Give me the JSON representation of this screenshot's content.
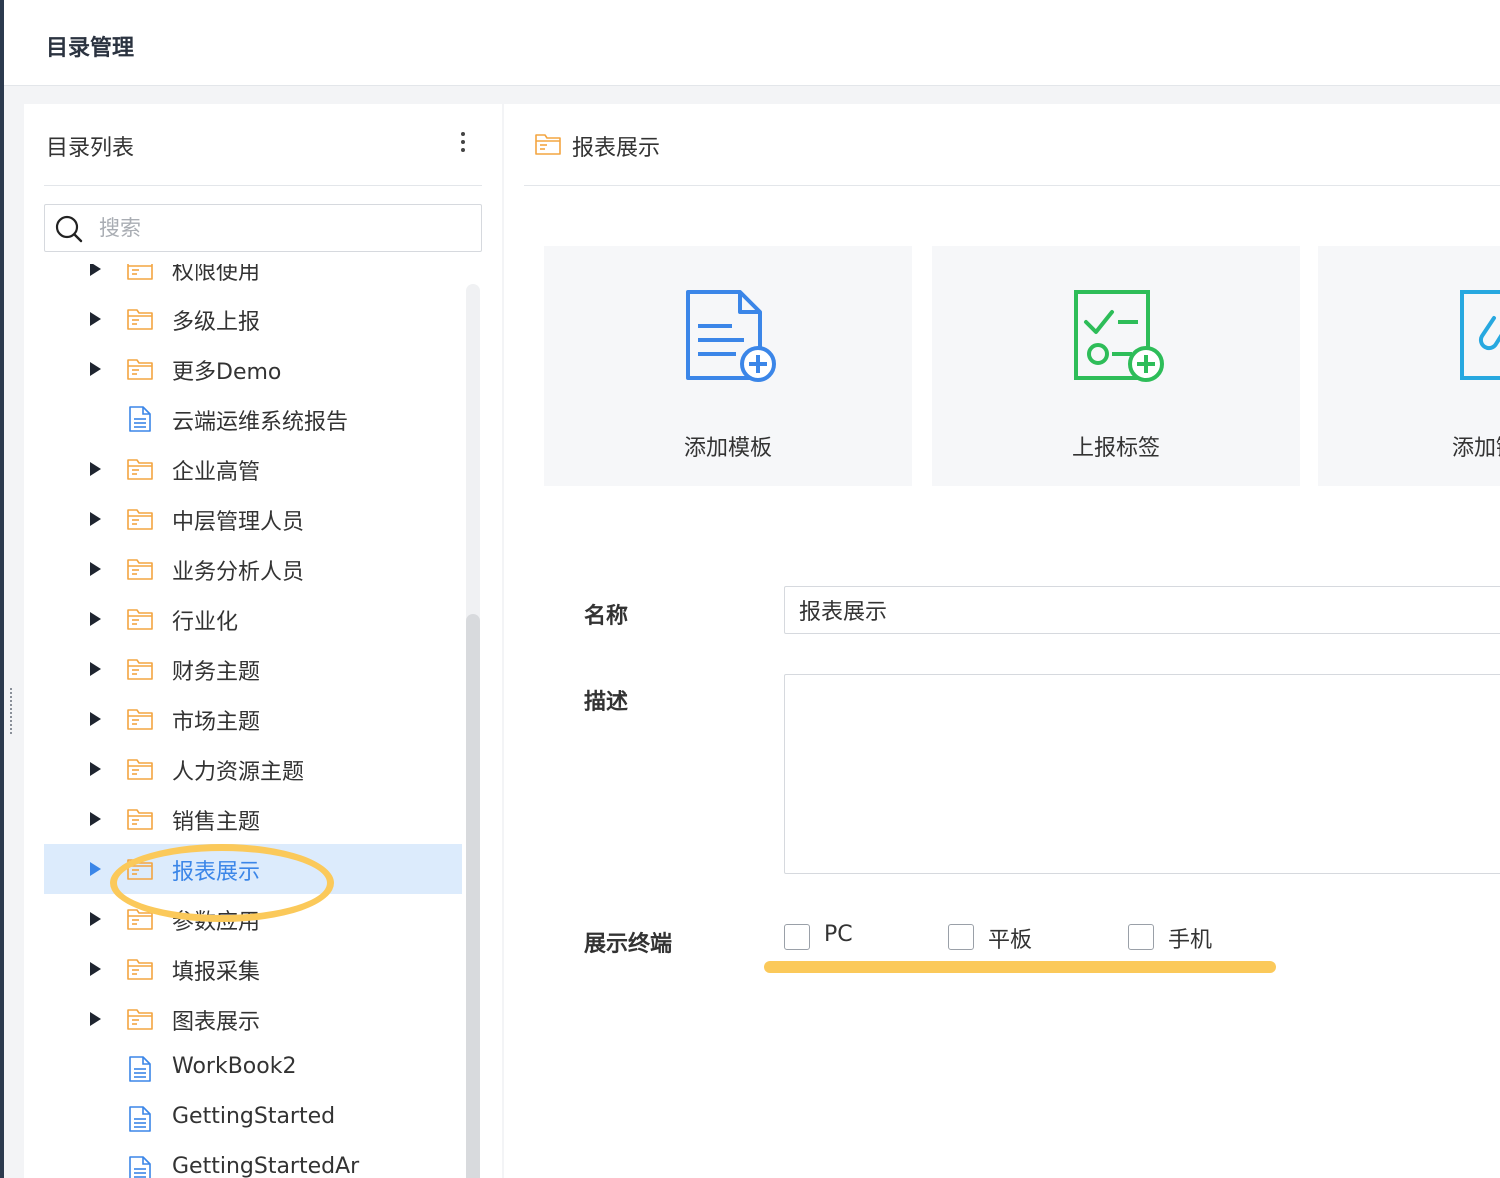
{
  "page": {
    "title": "目录管理"
  },
  "left_panel": {
    "title": "目录列表",
    "search": {
      "placeholder": "搜索",
      "value": ""
    },
    "items": [
      {
        "label": "权限使用",
        "type": "folder",
        "expandable": true,
        "selected": false
      },
      {
        "label": "多级上报",
        "type": "folder",
        "expandable": true,
        "selected": false
      },
      {
        "label": "更多Demo",
        "type": "folder",
        "expandable": true,
        "selected": false
      },
      {
        "label": "云端运维系统报告",
        "type": "file",
        "expandable": false,
        "selected": false
      },
      {
        "label": "企业高管",
        "type": "folder",
        "expandable": true,
        "selected": false
      },
      {
        "label": "中层管理人员",
        "type": "folder",
        "expandable": true,
        "selected": false
      },
      {
        "label": "业务分析人员",
        "type": "folder",
        "expandable": true,
        "selected": false
      },
      {
        "label": "行业化",
        "type": "folder",
        "expandable": true,
        "selected": false
      },
      {
        "label": "财务主题",
        "type": "folder",
        "expandable": true,
        "selected": false
      },
      {
        "label": "市场主题",
        "type": "folder",
        "expandable": true,
        "selected": false
      },
      {
        "label": "人力资源主题",
        "type": "folder",
        "expandable": true,
        "selected": false
      },
      {
        "label": "销售主题",
        "type": "folder",
        "expandable": true,
        "selected": false
      },
      {
        "label": "报表展示",
        "type": "folder",
        "expandable": true,
        "selected": true
      },
      {
        "label": "参数应用",
        "type": "folder",
        "expandable": true,
        "selected": false
      },
      {
        "label": "填报采集",
        "type": "folder",
        "expandable": true,
        "selected": false
      },
      {
        "label": "图表展示",
        "type": "folder",
        "expandable": true,
        "selected": false
      },
      {
        "label": "WorkBook2",
        "type": "file",
        "expandable": false,
        "selected": false
      },
      {
        "label": "GettingStarted",
        "type": "file",
        "expandable": false,
        "selected": false
      },
      {
        "label": "GettingStartedAr",
        "type": "file",
        "expandable": false,
        "selected": false
      }
    ]
  },
  "right_panel": {
    "title": "报表展示",
    "cards": [
      {
        "label": "添加模板",
        "icon": "add-template-icon",
        "color": "#3b86e8"
      },
      {
        "label": "上报标签",
        "icon": "report-tag-icon",
        "color": "#2ebd59"
      },
      {
        "label": "添加链接",
        "icon": "add-link-icon",
        "color": "#27a8e0"
      }
    ],
    "form": {
      "name_label": "名称",
      "name_value": "报表展示",
      "desc_label": "描述",
      "desc_value": "",
      "terminal_label": "展示终端",
      "terminals": [
        {
          "label": "PC",
          "checked": false
        },
        {
          "label": "平板",
          "checked": false
        },
        {
          "label": "手机",
          "checked": false
        }
      ]
    }
  },
  "colors": {
    "accent": "#3b86e8",
    "folder": "#f3a541",
    "highlight": "#fbc95a",
    "selected_bg": "#dcebfc"
  }
}
